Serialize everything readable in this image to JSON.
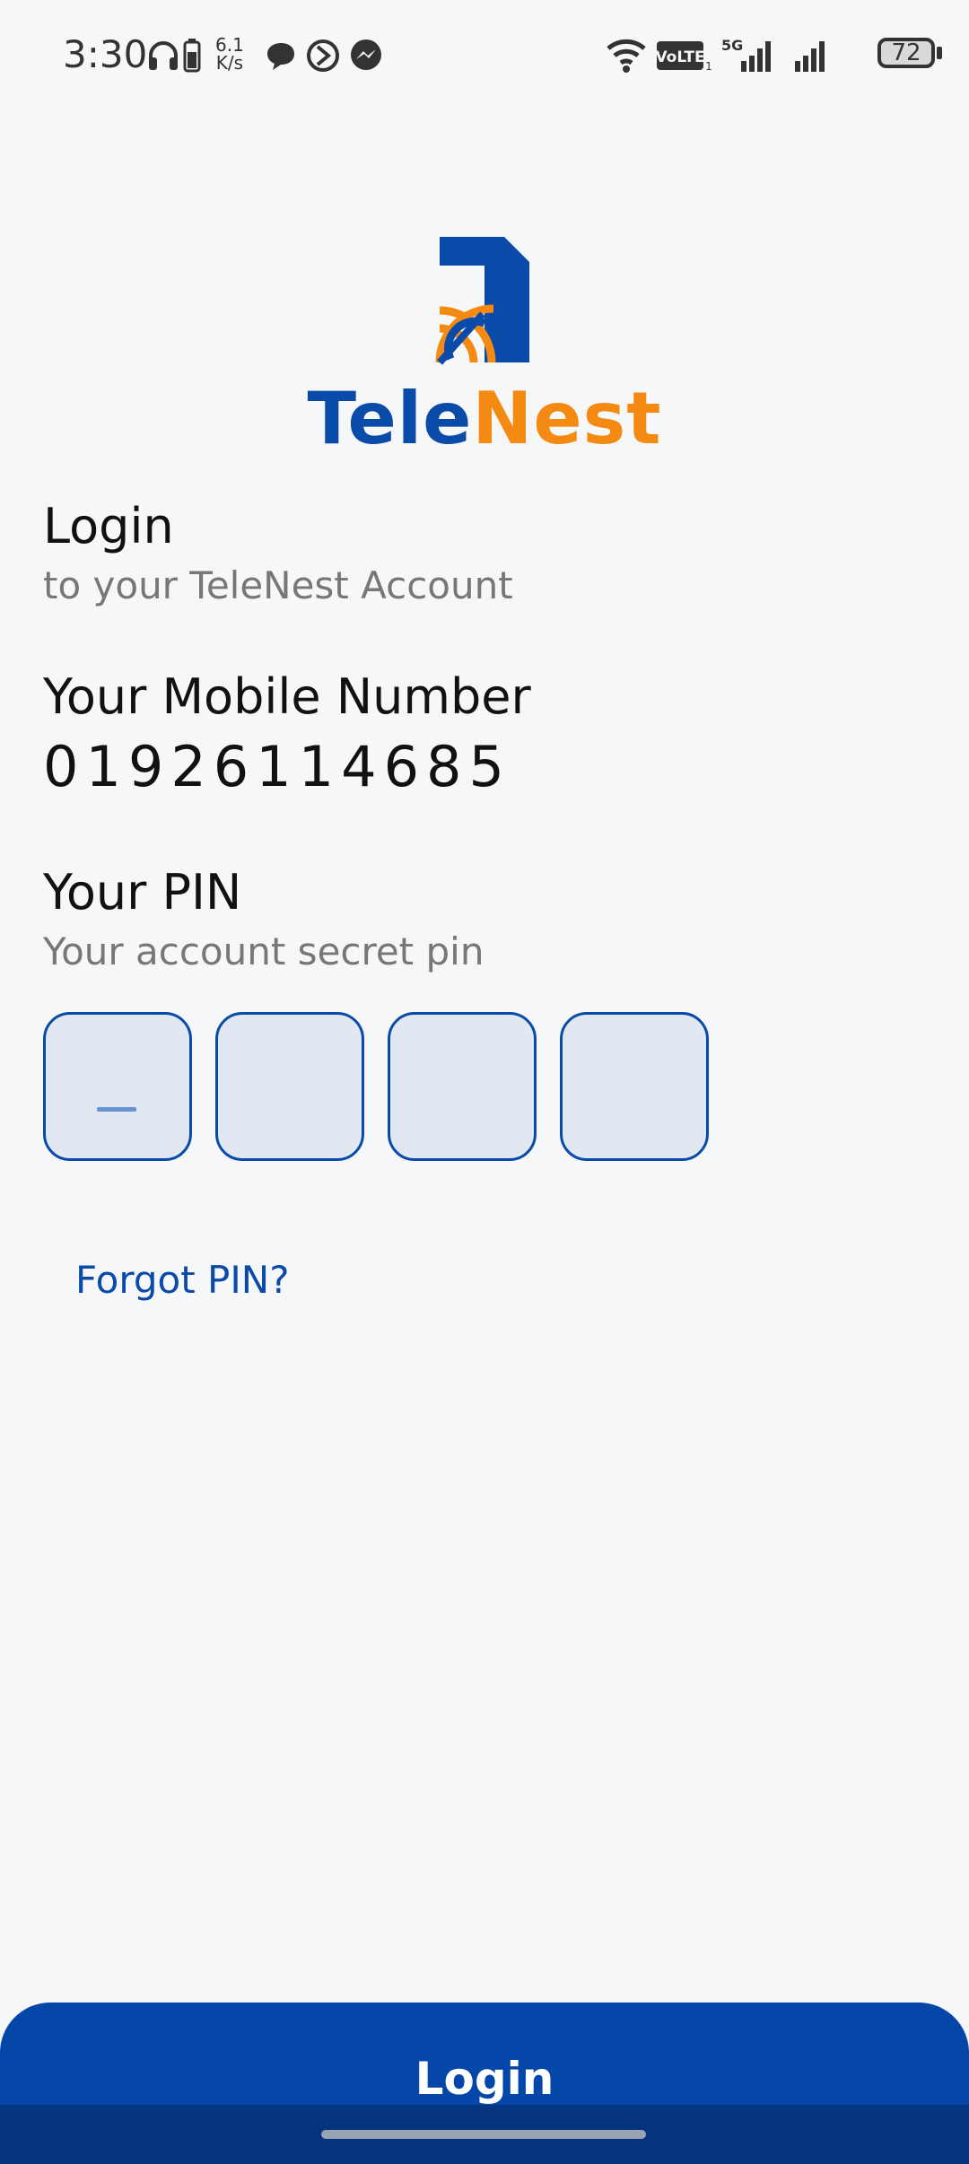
{
  "status_bar": {
    "time": "3:30",
    "net_speed_top": "6.1",
    "net_speed_bottom": "K/s",
    "battery": "72",
    "icons": [
      "headphones-icon",
      "battery-small-icon",
      "chat-icon",
      "clock-icon",
      "messenger-icon",
      "wifi-icon",
      "volte-icon",
      "5g-signal-icon",
      "signal-icon"
    ]
  },
  "brand": {
    "part1": "Tele",
    "part2": "Nest",
    "blue": "#0a4aa8",
    "orange": "#f58a12"
  },
  "login": {
    "title": "Login",
    "subtitle": "to your TeleNest Account"
  },
  "mobile": {
    "label": "Your Mobile Number",
    "value": "01926114685"
  },
  "pin": {
    "label": "Your PIN",
    "sublabel": "Your account secret pin",
    "digits": [
      "",
      "",
      "",
      ""
    ]
  },
  "forgot_pin": "Forgot PIN?",
  "login_button": "Login",
  "colors": {
    "primary": "#0447a8",
    "accent": "#f58a12",
    "background": "#f6f7f9"
  }
}
